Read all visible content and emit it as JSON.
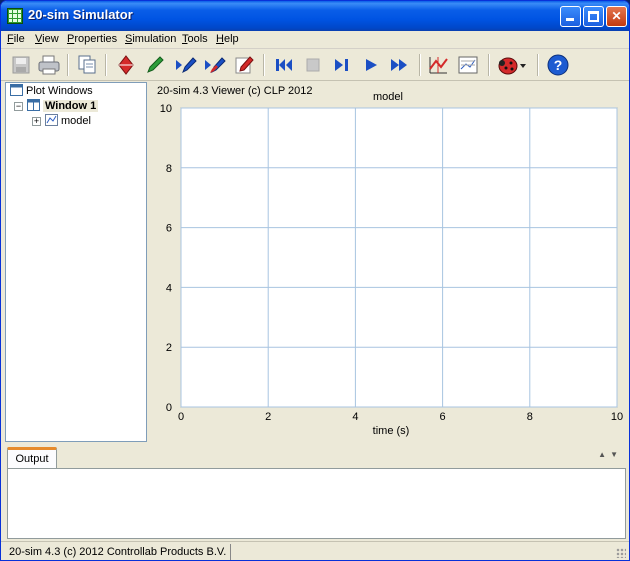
{
  "window": {
    "title": "20-sim Simulator"
  },
  "menu": [
    {
      "label": "File",
      "accel": "F",
      "rest": "ile"
    },
    {
      "label": "View",
      "accel": "V",
      "rest": "iew"
    },
    {
      "label": "Properties",
      "accel": "P",
      "rest": "roperties"
    },
    {
      "label": "Simulation",
      "accel": "S",
      "rest": "imulation"
    },
    {
      "label": "Tools",
      "accel": "T",
      "rest": "ools"
    },
    {
      "label": "Help",
      "accel": "H",
      "rest": "elp"
    }
  ],
  "toolbar": {
    "icons": [
      "save-icon",
      "print-icon",
      "copy-icon",
      "properties-icon",
      "green-pen-icon",
      "step-pen-icon",
      "multi-pen-icon",
      "edit-pen-icon",
      "rewind-icon",
      "stop-icon",
      "step-icon",
      "play-icon",
      "fast-forward-icon",
      "plot-icon",
      "plot-properties-icon",
      "debug-ladybug-icon",
      "help-icon"
    ]
  },
  "tree": {
    "root": "Plot Windows",
    "window": "Window 1",
    "plot": "model"
  },
  "plot": {
    "header": "20-sim 4.3 Viewer (c) CLP 2012"
  },
  "chart_data": {
    "type": "line",
    "title": "model",
    "xlabel": "time (s)",
    "ylabel": "",
    "xlim": [
      0,
      10
    ],
    "ylim": [
      0,
      10
    ],
    "xticks": [
      0,
      2,
      4,
      6,
      8,
      10
    ],
    "yticks": [
      0,
      2,
      4,
      6,
      8,
      10
    ],
    "grid": true,
    "series": []
  },
  "output": {
    "tab": "Output"
  },
  "status": {
    "text": "20-sim 4.3 (c) 2012 Controllab Products B.V."
  },
  "colors": {
    "grid": "#a8c4e0",
    "titlebar": "#0054e3",
    "tab_accent": "#e68b2c"
  }
}
